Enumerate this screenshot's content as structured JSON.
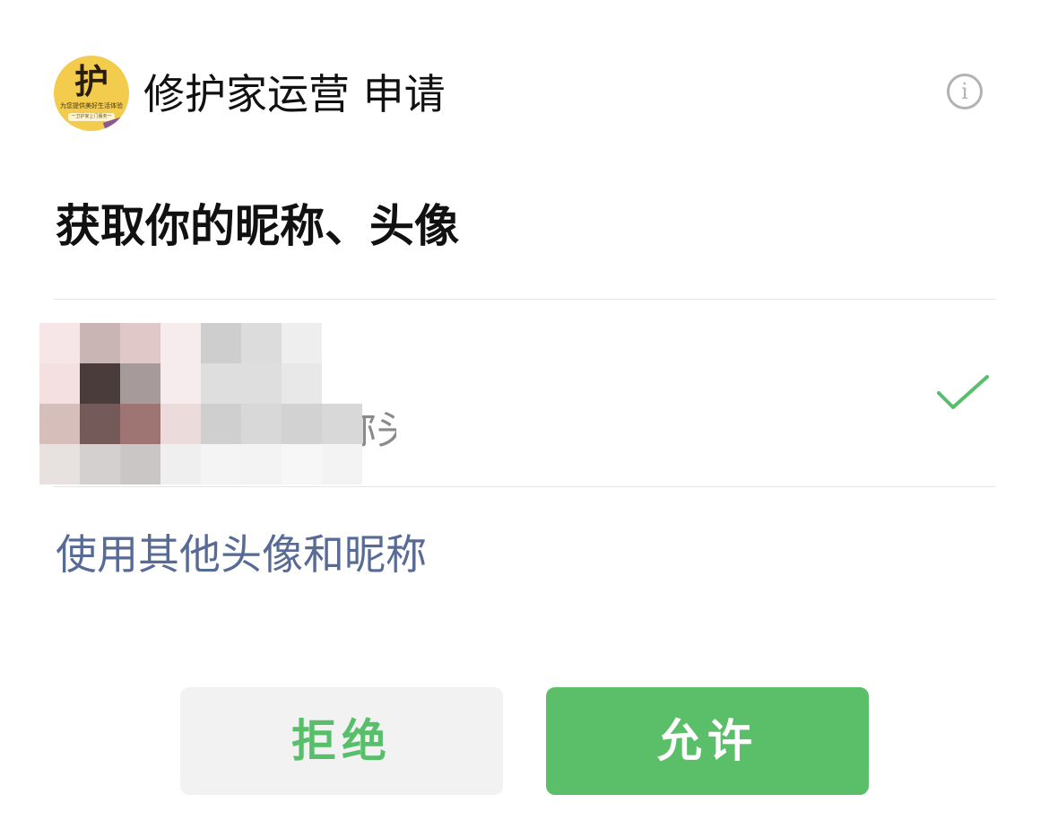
{
  "header": {
    "app_name": "修护家运营 申请",
    "logo": {
      "char": "护",
      "tagline": "为您提供美好生活体验",
      "ribbon": "一卫护家上门服务一"
    },
    "info_icon": "info-circle-icon"
  },
  "permission": {
    "title": "获取你的昵称、头像"
  },
  "account_option": {
    "subtitle_visible": "称头像",
    "selected": true,
    "check_icon": "checkmark-icon",
    "check_color": "#57be6a",
    "mosaic": [
      [
        "#f6e6e8",
        "#c8b5b4",
        "#dfc8c7",
        "#f7eced",
        "#cecece",
        "#dcdcdc",
        "#eeeeee",
        "#ffffff"
      ],
      [
        "#f4dfe1",
        "#4a3c3b",
        "#a79a9b",
        "#f7eced",
        "#dedede",
        "#dedede",
        "#e8e8e8",
        "#ffffff"
      ],
      [
        "#d6bfba",
        "#745b59",
        "#9e7572",
        "#ebdcdb",
        "#cfcfcf",
        "#d8d8d8",
        "#d2d2d2",
        "#d8d8d8"
      ],
      [
        "#e7e2e0",
        "#d4d0cf",
        "#c9c6c5",
        "#efefef",
        "#f4f4f4",
        "#f3f3f3",
        "#f7f7f7",
        "#f3f3f3"
      ]
    ]
  },
  "other_option": {
    "label": "使用其他头像和昵称",
    "color": "#576b95"
  },
  "buttons": {
    "reject_label": "拒绝",
    "allow_label": "允许",
    "reject_text_color": "#57be6a",
    "allow_bg_color": "#5bbf6a"
  }
}
